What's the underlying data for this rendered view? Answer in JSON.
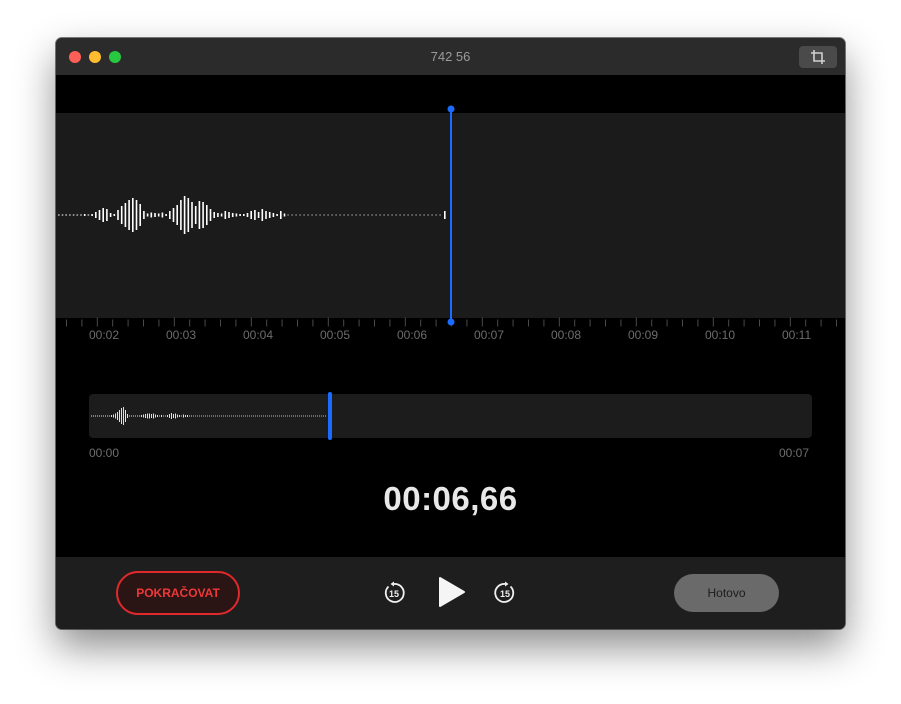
{
  "window": {
    "title": "742 56"
  },
  "timeline": {
    "ticks": [
      "00:02",
      "00:03",
      "00:04",
      "00:05",
      "00:06",
      "00:07",
      "00:08",
      "00:09",
      "00:10",
      "00:11"
    ]
  },
  "overview": {
    "start": "00:00",
    "end": "00:07"
  },
  "playback": {
    "current_time": "00:06,66"
  },
  "controls": {
    "resume_label": "POKRAČOVAT",
    "done_label": "Hotovo",
    "skip_back_label": "15",
    "skip_forward_label": "15"
  },
  "colors": {
    "accent": "#1a6bff",
    "record_red": "#ee3838",
    "background": "#000000"
  }
}
